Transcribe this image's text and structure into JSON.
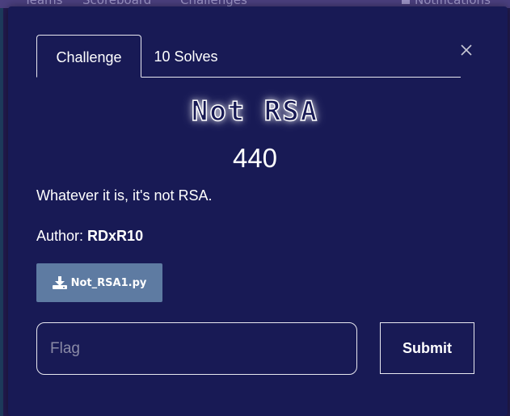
{
  "nav": {
    "teams": "Teams",
    "scoreboard": "Scoreboard",
    "challenges": "Challenges",
    "notifications": "Notifications"
  },
  "modal": {
    "tabs": [
      {
        "label": "Challenge",
        "active": true
      },
      {
        "label": "10 Solves",
        "active": false
      }
    ],
    "title": "Not RSA",
    "value": "440",
    "description": "Whatever it is, it's not RSA.",
    "author_label": "Author: ",
    "author_name": "RDxR10",
    "file": {
      "name": "Not_RSA1.py",
      "icon": "download-icon"
    },
    "flag_placeholder": "Flag",
    "submit_label": "Submit",
    "close_icon": "close-icon"
  },
  "colors": {
    "modal_bg": "#181a55",
    "page_bg": "#221b4f",
    "file_button": "#5e7ba2",
    "text": "#ffffff"
  }
}
